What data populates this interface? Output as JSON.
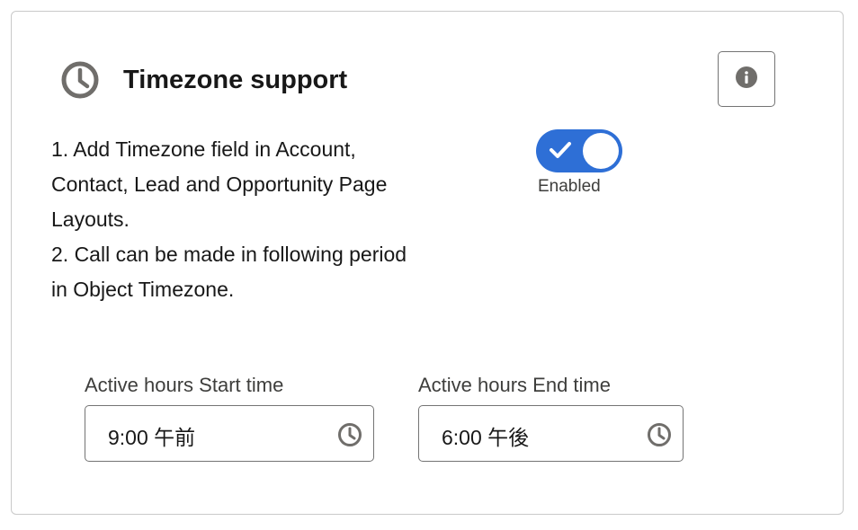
{
  "header": {
    "title": "Timezone support",
    "icon": "clock-icon",
    "info_icon": "info-icon"
  },
  "description": {
    "lines": [
      "1. Add Timezone field in Account,",
      "Contact, Lead and Opportunity Page",
      "Layouts.",
      "2. Call can be made in following period",
      "in Object Timezone."
    ]
  },
  "toggle": {
    "state": "on",
    "label": "Enabled",
    "color": "#2e6fd6"
  },
  "fields": {
    "start": {
      "label": "Active hours Start time",
      "value": "9:00 午前",
      "icon": "clock-icon"
    },
    "end": {
      "label": "Active hours End time",
      "value": "6:00 午後",
      "icon": "clock-icon"
    }
  }
}
